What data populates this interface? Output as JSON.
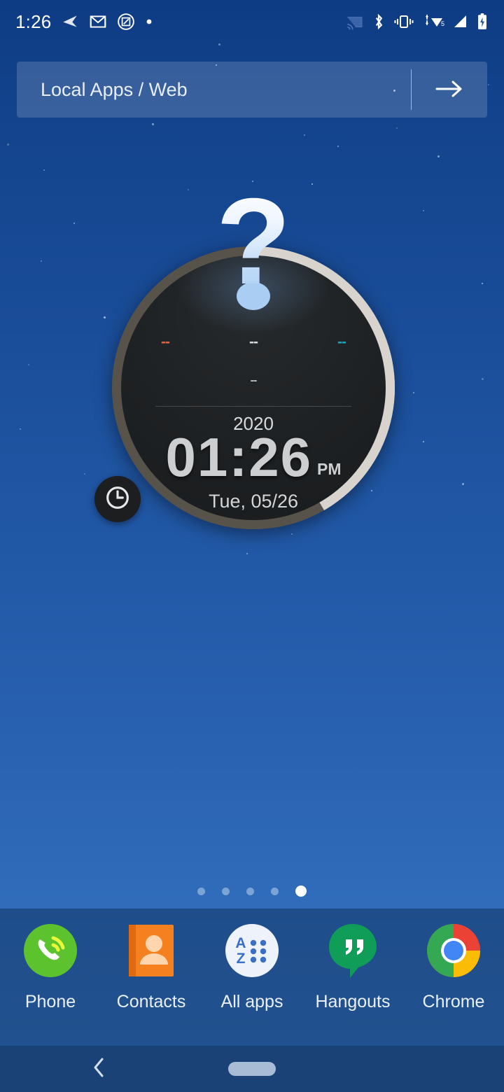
{
  "status_bar": {
    "time": "1:26",
    "left_icons": [
      "navigation-arrow-icon",
      "gmail-icon",
      "compose-icon",
      "dot-icon"
    ],
    "right_icons": [
      "cast-icon",
      "bluetooth-icon",
      "vibrate-icon",
      "wifi-icon",
      "cellular-signal-icon",
      "battery-charging-icon"
    ],
    "wifi_badge": "5"
  },
  "search": {
    "placeholder": "Local Apps / Web",
    "value": "",
    "go_icon": "arrow-right-icon"
  },
  "clock_widget": {
    "question_mark": "?",
    "dash_left": "--",
    "dash_center": "--",
    "dash_right": "--",
    "dash_sub": "--",
    "year": "2020",
    "time": "01:26",
    "ampm": "PM",
    "date": "Tue, 05/26",
    "badge_icon": "clock-icon",
    "colors": {
      "dash_left": "#e8613c",
      "dash_center": "#d9dadb",
      "dash_right": "#17a5c4",
      "ring_light": "#d8d4cd",
      "ring_dark": "#57524a",
      "face": "#1e2123",
      "accent_dot": "#a9cdf3"
    }
  },
  "page_indicator": {
    "count": 5,
    "active_index": 4
  },
  "dock": {
    "items": [
      {
        "label": "Phone",
        "icon": "phone-icon",
        "color": "#5cc22d"
      },
      {
        "label": "Contacts",
        "icon": "contacts-icon",
        "color": "#f4801f"
      },
      {
        "label": "All apps",
        "icon": "all-apps-icon",
        "color": "#ffffff"
      },
      {
        "label": "Hangouts",
        "icon": "hangouts-icon",
        "color": "#0f9d58"
      },
      {
        "label": "Chrome",
        "icon": "chrome-icon",
        "color": "#4285f4"
      }
    ]
  },
  "nav_bar": {
    "back_icon": "chevron-left-icon",
    "home_icon": "home-pill-icon"
  },
  "theme": {
    "wallpaper_top": "#0e3c84",
    "wallpaper_bottom": "#3576c2",
    "dock_overlay": "rgba(6,30,68,.40)",
    "nav_bar": "#1b4277"
  }
}
